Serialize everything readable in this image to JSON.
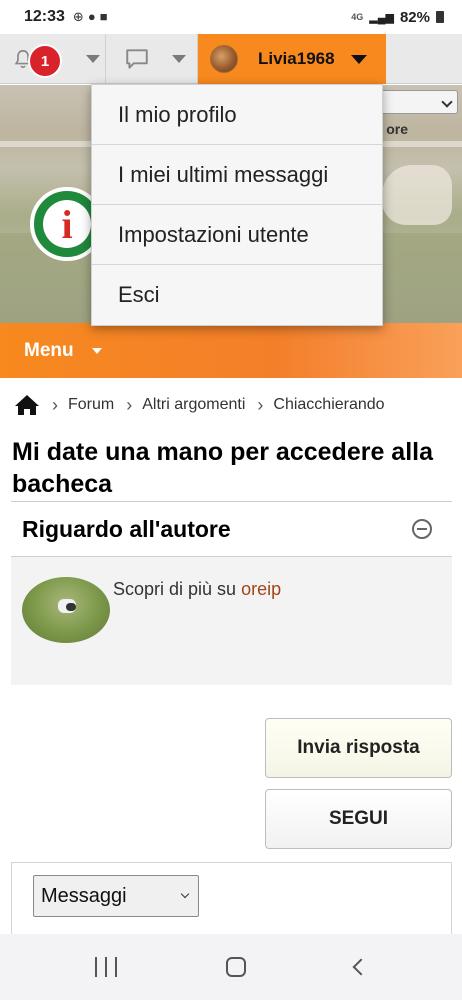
{
  "status_bar": {
    "time": "12:33",
    "network": "4G",
    "battery": "82%",
    "icons": [
      "toyota-icon",
      "facebook-icon",
      "shopping-bag-icon",
      "signal-icon",
      "battery-icon"
    ]
  },
  "user_bar": {
    "notification_count": "1",
    "username": "Livia1968",
    "accent_color": "#f7891f",
    "badge_color": "#d9232a"
  },
  "banner": {
    "partial_text": "ore"
  },
  "user_menu": {
    "items": [
      {
        "label": "Il mio profilo"
      },
      {
        "label": "I miei ultimi messaggi"
      },
      {
        "label": "Impostazioni utente"
      },
      {
        "label": "Esci"
      }
    ]
  },
  "menu_bar": {
    "label": "Menu"
  },
  "breadcrumb": {
    "items": [
      "Forum",
      "Altri argomenti",
      "Chiacchierando"
    ]
  },
  "topic": {
    "title": "Mi date una mano per accedere alla bacheca"
  },
  "author_box": {
    "heading": "Riguardo all'autore",
    "text_prefix": "Scopri di più su ",
    "author_name": "oreip"
  },
  "actions": {
    "reply_label": "Invia risposta",
    "follow_label": "SEGUI"
  },
  "messages_filter": {
    "selected": "Messaggi"
  }
}
